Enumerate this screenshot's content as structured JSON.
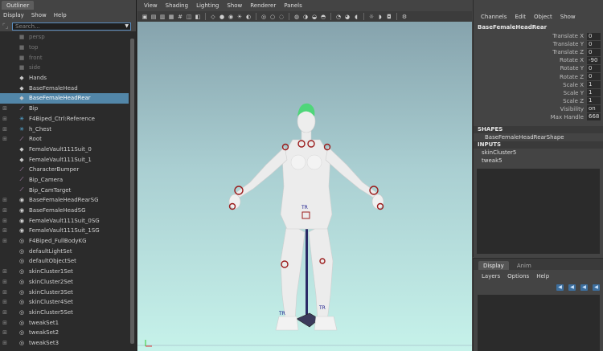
{
  "outliner": {
    "title": "Outliner",
    "menu": [
      "Display",
      "Show",
      "Help"
    ],
    "search": {
      "value": "",
      "placeholder": "Search..."
    },
    "items": [
      {
        "label": "persp",
        "icon": "camera-icon",
        "dim": true,
        "expander": ""
      },
      {
        "label": "top",
        "icon": "camera-icon",
        "dim": true,
        "expander": ""
      },
      {
        "label": "front",
        "icon": "camera-icon",
        "dim": true,
        "expander": ""
      },
      {
        "label": "side",
        "icon": "camera-icon",
        "dim": true,
        "expander": ""
      },
      {
        "label": "Hands",
        "icon": "mesh-icon",
        "dim": false,
        "expander": ""
      },
      {
        "label": "BaseFemaleHead",
        "icon": "mesh-icon",
        "dim": false,
        "expander": ""
      },
      {
        "label": "BaseFemaleHeadRear",
        "icon": "mesh-icon",
        "dim": false,
        "expander": "",
        "selected": true
      },
      {
        "label": "Bip",
        "icon": "joint-icon",
        "dim": false,
        "expander": "+"
      },
      {
        "label": "F4Biped_Ctrl:Reference",
        "icon": "locator-icon",
        "dim": false,
        "expander": "+"
      },
      {
        "label": "h_Chest",
        "icon": "locator-icon",
        "dim": false,
        "expander": "+"
      },
      {
        "label": "Root",
        "icon": "joint-icon",
        "dim": false,
        "expander": "+"
      },
      {
        "label": "FemaleVault111Suit_0",
        "icon": "mesh-icon",
        "dim": false,
        "expander": ""
      },
      {
        "label": "FemaleVault111Suit_1",
        "icon": "mesh-icon",
        "dim": false,
        "expander": ""
      },
      {
        "label": "CharacterBumper",
        "icon": "joint-icon",
        "dim": false,
        "expander": ""
      },
      {
        "label": "Bip_Camera",
        "icon": "joint-icon",
        "dim": false,
        "expander": ""
      },
      {
        "label": "Bip_CamTarget",
        "icon": "joint-icon",
        "dim": false,
        "expander": ""
      },
      {
        "label": "BaseFemaleHeadRearSG",
        "icon": "shading-group-icon",
        "dim": false,
        "expander": "+"
      },
      {
        "label": "BaseFemaleHeadSG",
        "icon": "shading-group-icon",
        "dim": false,
        "expander": "+"
      },
      {
        "label": "FemaleVault111Suit_0SG",
        "icon": "shading-group-icon",
        "dim": false,
        "expander": "+"
      },
      {
        "label": "FemaleVault111Suit_1SG",
        "icon": "shading-group-icon",
        "dim": false,
        "expander": "+"
      },
      {
        "label": "F4Biped_FullBodyKG",
        "icon": "set-icon",
        "dim": false,
        "expander": "+"
      },
      {
        "label": "defaultLightSet",
        "icon": "set-icon",
        "dim": false,
        "expander": ""
      },
      {
        "label": "defaultObjectSet",
        "icon": "set-icon",
        "dim": false,
        "expander": ""
      },
      {
        "label": "skinCluster1Set",
        "icon": "set-icon",
        "dim": false,
        "expander": "+"
      },
      {
        "label": "skinCluster2Set",
        "icon": "set-icon",
        "dim": false,
        "expander": "+"
      },
      {
        "label": "skinCluster3Set",
        "icon": "set-icon",
        "dim": false,
        "expander": "+"
      },
      {
        "label": "skinCluster4Set",
        "icon": "set-icon",
        "dim": false,
        "expander": "+"
      },
      {
        "label": "skinCluster5Set",
        "icon": "set-icon",
        "dim": false,
        "expander": "+"
      },
      {
        "label": "tweakSet1",
        "icon": "set-icon",
        "dim": false,
        "expander": "+"
      },
      {
        "label": "tweakSet2",
        "icon": "set-icon",
        "dim": false,
        "expander": "+"
      },
      {
        "label": "tweakSet3",
        "icon": "set-icon",
        "dim": false,
        "expander": "+"
      }
    ]
  },
  "viewport": {
    "menu": [
      "View",
      "Shading",
      "Lighting",
      "Show",
      "Renderer",
      "Panels"
    ],
    "markers": [
      "TR",
      "TR",
      "TR"
    ],
    "colors": {
      "sky_top": "#86a3ad",
      "sky_bottom": "#c6f2ea",
      "skin": "#ececec",
      "hair": "#4fd67a",
      "control": "#9b1c1c"
    }
  },
  "channel_box": {
    "menu": [
      "Channels",
      "Edit",
      "Object",
      "Show"
    ],
    "object_name": "BaseFemaleHeadRear",
    "attributes": [
      {
        "label": "Translate X",
        "value": "0"
      },
      {
        "label": "Translate Y",
        "value": "0"
      },
      {
        "label": "Translate Z",
        "value": "0"
      },
      {
        "label": "Rotate X",
        "value": "-90"
      },
      {
        "label": "Rotate Y",
        "value": "0"
      },
      {
        "label": "Rotate Z",
        "value": "0"
      },
      {
        "label": "Scale X",
        "value": "1"
      },
      {
        "label": "Scale Y",
        "value": "1"
      },
      {
        "label": "Scale Z",
        "value": "1"
      },
      {
        "label": "Visibility",
        "value": "on"
      },
      {
        "label": "Max Handle",
        "value": "668"
      }
    ],
    "shapes_header": "SHAPES",
    "shape_name": "BaseFemaleHeadRearShape",
    "inputs_header": "INPUTS",
    "inputs": [
      "skinCluster5",
      "tweak5"
    ]
  },
  "layer_editor": {
    "tabs": [
      "Display",
      "Anim"
    ],
    "menu": [
      "Layers",
      "Options",
      "Help"
    ]
  }
}
